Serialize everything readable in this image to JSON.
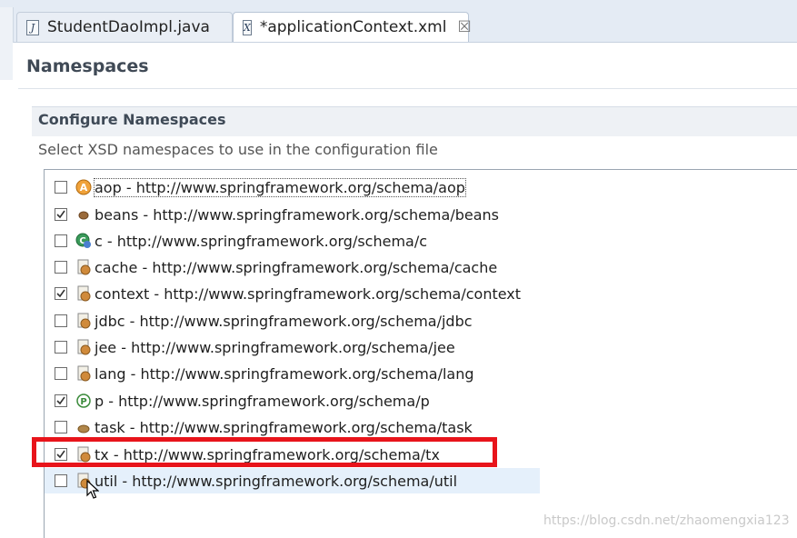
{
  "tabs": [
    {
      "label": "StudentDaoImpl.java",
      "icon": "java-file-icon",
      "icon_glyph": "J"
    },
    {
      "label": "*applicationContext.xml",
      "icon": "xml-file-icon",
      "icon_glyph": "X",
      "close": "☒"
    }
  ],
  "page_title": "Namespaces",
  "group": {
    "title": "Configure Namespaces",
    "description": "Select XSD namespaces to use in the configuration file"
  },
  "namespaces": [
    {
      "label": "aop - http://www.springframework.org/schema/aop",
      "checked": false,
      "icon": "aop-icon"
    },
    {
      "label": "beans - http://www.springframework.org/schema/beans",
      "checked": true,
      "icon": "bean-icon"
    },
    {
      "label": "c - http://www.springframework.org/schema/c",
      "checked": false,
      "icon": "c-namespace-icon"
    },
    {
      "label": "cache - http://www.springframework.org/schema/cache",
      "checked": false,
      "icon": "xsd-file-icon"
    },
    {
      "label": "context - http://www.springframework.org/schema/context",
      "checked": true,
      "icon": "xsd-file-icon"
    },
    {
      "label": "jdbc - http://www.springframework.org/schema/jdbc",
      "checked": false,
      "icon": "xsd-file-icon"
    },
    {
      "label": "jee - http://www.springframework.org/schema/jee",
      "checked": false,
      "icon": "xsd-file-icon"
    },
    {
      "label": "lang - http://www.springframework.org/schema/lang",
      "checked": false,
      "icon": "xsd-file-icon"
    },
    {
      "label": "p - http://www.springframework.org/schema/p",
      "checked": true,
      "icon": "p-namespace-icon"
    },
    {
      "label": "task - http://www.springframework.org/schema/task",
      "checked": false,
      "icon": "task-icon"
    },
    {
      "label": "tx - http://www.springframework.org/schema/tx",
      "checked": true,
      "icon": "xsd-file-icon"
    },
    {
      "label": "util - http://www.springframework.org/schema/util",
      "checked": false,
      "icon": "xsd-file-icon"
    }
  ],
  "colors": {
    "highlight": "#e8141b",
    "hover_row": "#e5f0fb"
  },
  "watermark": "https://blog.csdn.net/zhaomengxia123"
}
